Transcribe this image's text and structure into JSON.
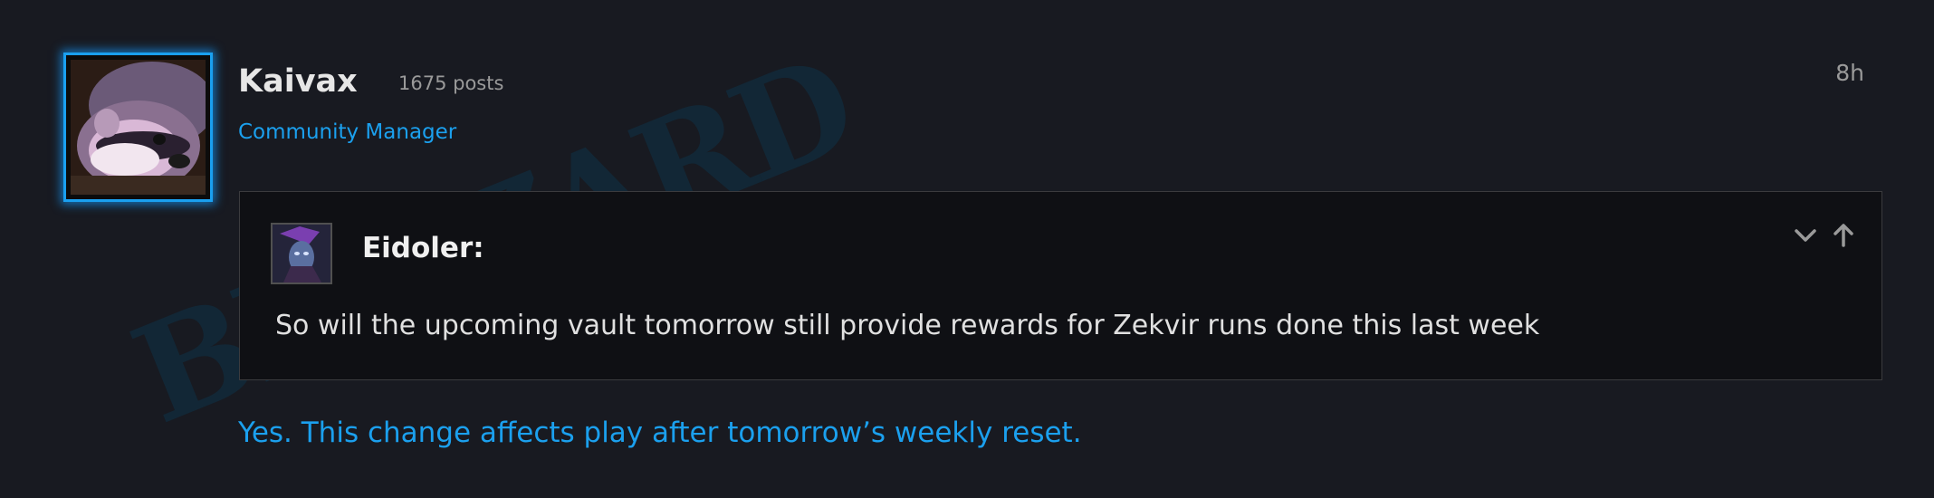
{
  "post": {
    "username": "Kaivax",
    "post_count": "1675 posts",
    "user_title": "Community Manager",
    "time": "8h",
    "watermark_text": "BLIZZARD"
  },
  "quote": {
    "author": "Eidoler:",
    "text": "So will the upcoming vault tomorrow still provide rewards for Zekvir runs done this last week"
  },
  "reply": {
    "text": "Yes. This change affects play after tomorrow’s weekly reset."
  },
  "icons": {
    "expand": "chevron-down-icon",
    "jump": "arrow-up-icon"
  },
  "colors": {
    "background": "#181a21",
    "quote_background": "#0f1014",
    "accent_blue": "#1ba0ee",
    "avatar_glow": "#1aa0f0"
  }
}
